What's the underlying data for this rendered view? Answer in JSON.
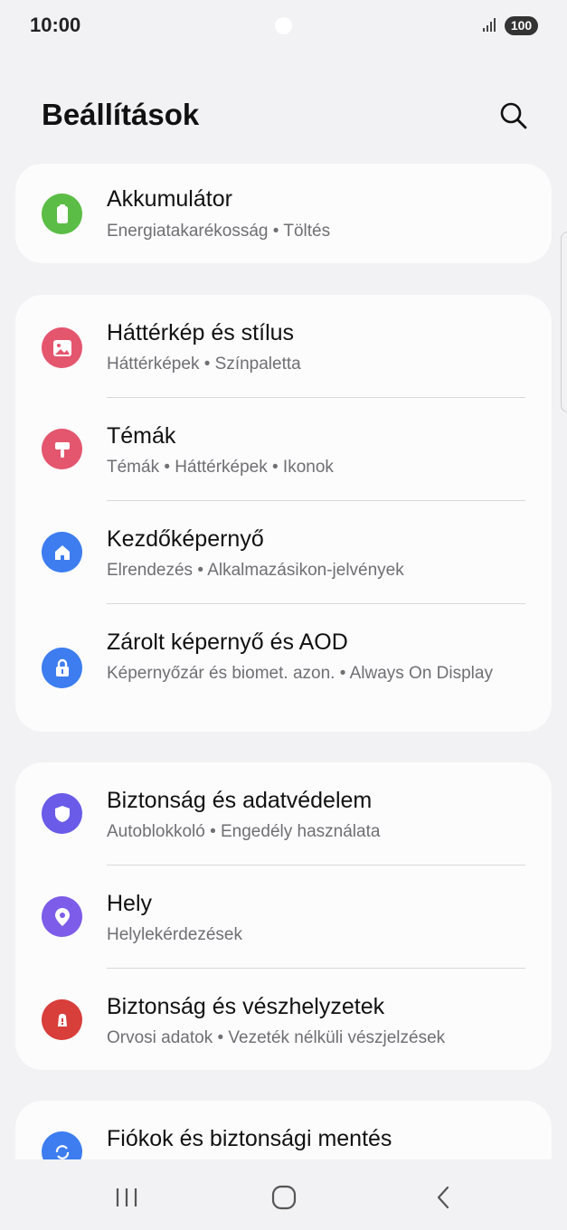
{
  "status": {
    "time": "10:00",
    "battery": "100"
  },
  "header": {
    "title": "Beállítások"
  },
  "groups": [
    {
      "items": [
        {
          "title": "Akkumulátor",
          "subtitle": "Energiatakarékosság • Töltés",
          "icon": "battery-icon",
          "color": "#5bbd45"
        }
      ]
    },
    {
      "items": [
        {
          "title": "Háttérkép és stílus",
          "subtitle": "Háttérképek • Színpaletta",
          "icon": "image-icon",
          "color": "#e4566e"
        },
        {
          "title": "Témák",
          "subtitle": "Témák • Háttérképek • Ikonok",
          "icon": "paintbrush-icon",
          "color": "#e4566e"
        },
        {
          "title": "Kezdőképernyő",
          "subtitle": "Elrendezés • Alkalmazásikon-jelvények",
          "icon": "home-icon",
          "color": "#3d7df0"
        },
        {
          "title": "Zárolt képernyő és AOD",
          "subtitle": "Képernyőzár és biomet. azon. • Always On Display",
          "icon": "lock-icon",
          "color": "#3d7df0"
        }
      ]
    },
    {
      "items": [
        {
          "title": "Biztonság és adatvédelem",
          "subtitle": "Autoblokkoló • Engedély használata",
          "icon": "shield-icon",
          "color": "#6a5ce8"
        },
        {
          "title": "Hely",
          "subtitle": "Helylekérdezések",
          "icon": "location-pin-icon",
          "color": "#7c5ce8"
        },
        {
          "title": "Biztonság és vészhelyzetek",
          "subtitle": "Orvosi adatok • Vezeték nélküli vészjelzések",
          "icon": "emergency-icon",
          "color": "#d83e3a"
        }
      ]
    },
    {
      "items": [
        {
          "title": "Fiókok és biztonsági mentés",
          "icon": "sync-icon",
          "color": "#3d7df0"
        }
      ]
    }
  ]
}
